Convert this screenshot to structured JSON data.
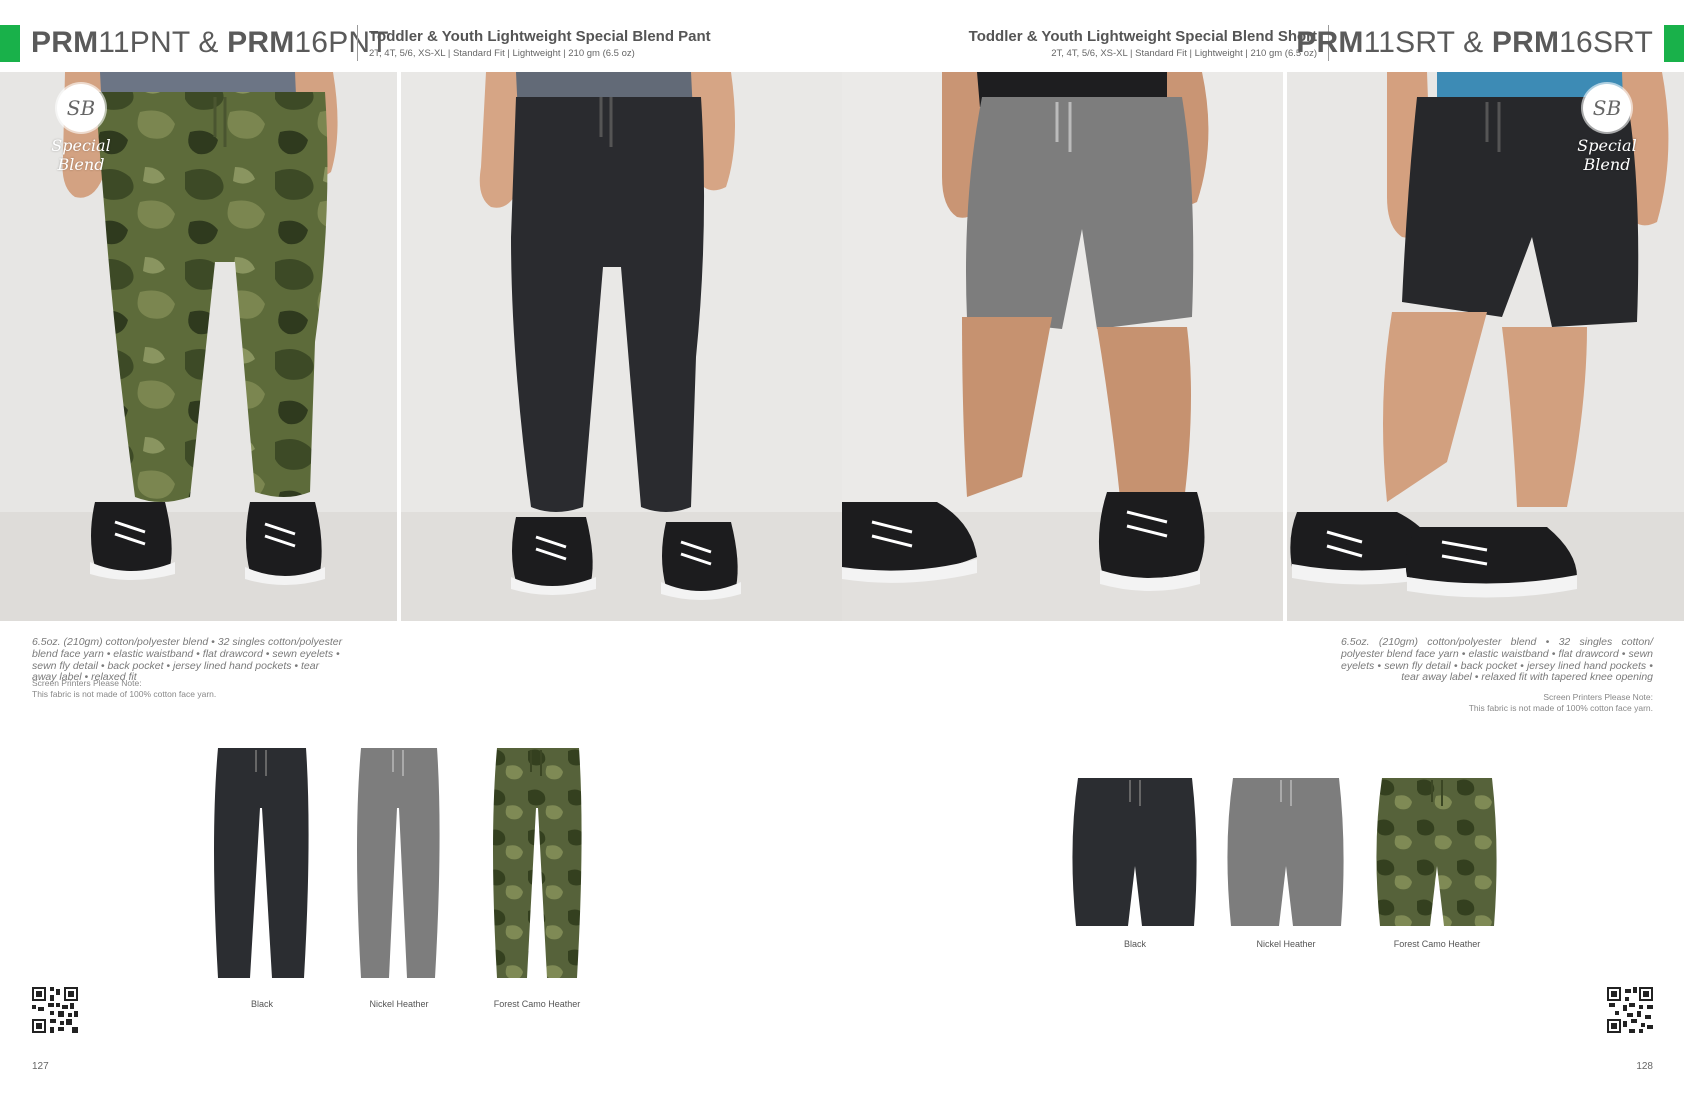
{
  "left_page": {
    "model_parts": [
      "PRM",
      "11PNT & ",
      "PRM",
      "16PNT"
    ],
    "title": "Toddler & Youth Lightweight Special Blend Pant",
    "spec": "2T, 4T, 5/6, XS-XL  |  Standard Fit  |  Lightweight  |  210 gm (6.5 oz)",
    "description": "6.5oz. (210gm) cotton/polyester blend • 32 singles cotton/polyester blend face yarn • elastic waistband • flat drawcord • sewn eyelets • sewn fly detail • back pocket • jersey lined hand pockets • tear away label • relaxed fit",
    "note_title": "Screen Printers Please Note:",
    "note_body": "This fabric is not made of 100% cotton face yarn.",
    "swatches": [
      {
        "label": "Black",
        "color": "#2b2d31"
      },
      {
        "label": "Nickel Heather",
        "color": "#7d7d7d"
      },
      {
        "label": "Forest Camo Heather",
        "color": "#4f5a32"
      }
    ],
    "page_number": "127"
  },
  "right_page": {
    "model_parts": [
      "PRM",
      "11SRT & ",
      "PRM",
      "16SRT"
    ],
    "title": "Toddler & Youth Lightweight Special Blend Short",
    "spec": "2T, 4T, 5/6, XS-XL  |  Standard Fit  |  Lightweight  |  210 gm (6.5 oz)",
    "description": "6.5oz. (210gm) cotton/polyester blend • 32 singles cotton/ polyester blend face yarn • elastic waistband • flat drawcord • sewn eyelets • sewn fly detail • back pocket • jersey lined hand pockets • tear away label • relaxed fit with tapered knee opening",
    "note_title": "Screen Printers Please Note:",
    "note_body": "This fabric is not made of 100% cotton face yarn.",
    "swatches": [
      {
        "label": "Black",
        "color": "#2b2d31"
      },
      {
        "label": "Nickel Heather",
        "color": "#7d7d7d"
      },
      {
        "label": "Forest Camo Heather",
        "color": "#4f5a32"
      }
    ],
    "page_number": "128"
  },
  "brand": {
    "monogram": "SB",
    "script": "Special Blend"
  },
  "colors": {
    "accent_green": "#19b14a",
    "black": "#2b2d31",
    "grey": "#7d7d7d",
    "camo": "#4f5a32"
  }
}
